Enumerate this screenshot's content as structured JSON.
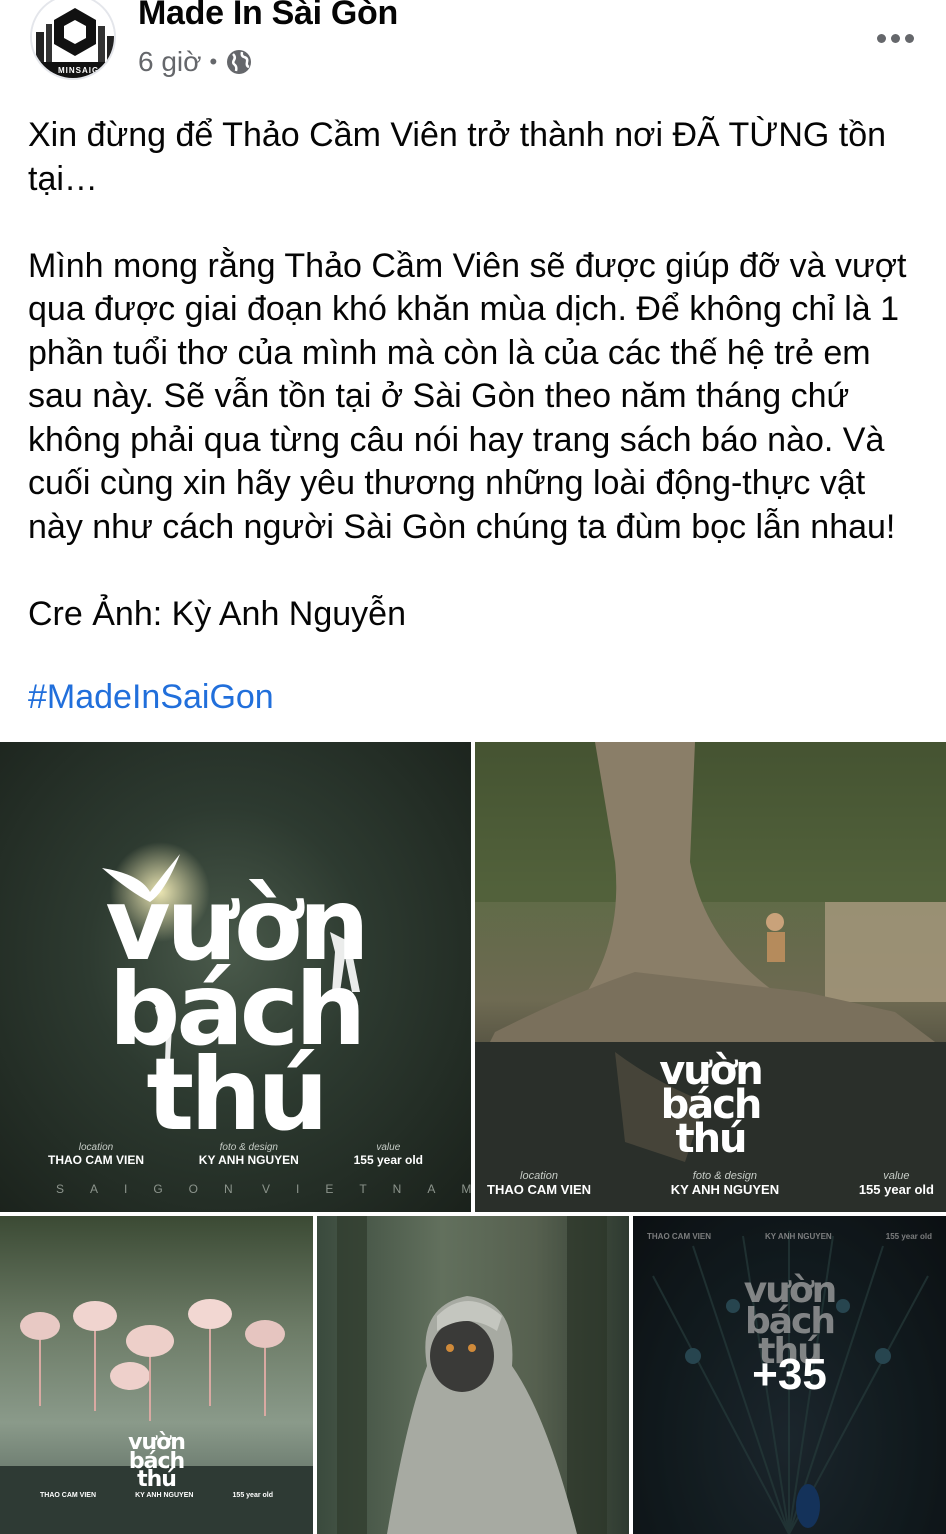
{
  "header": {
    "page_name": "Made In Sài Gòn",
    "time": "6 giờ",
    "separator": "•",
    "avatar_text": "MINSAIGON",
    "more_icon": "more-horizontal-icon",
    "privacy_icon": "globe-icon"
  },
  "post": {
    "text": "Xin đừng để Thảo Cầm Viên trở thành nơi ĐÃ TỪNG tồn tại…\n\nMình mong rằng Thảo Cầm Viên sẽ được giúp đỡ và vượt qua được giai đoạn khó khăn mùa dịch. Để không chỉ là 1 phần tuổi thơ của mình mà còn là của các thế hệ trẻ em sau này. Sẽ vẫn tồn tại ở Sài Gòn theo năm tháng chứ không phải qua từng câu nói hay trang sách báo nào. Và cuối cùng xin hãy yêu thương những loài động-thực vật này như cách người Sài Gòn chúng ta đùm bọc lẫn nhau!\n\nCre Ảnh: Kỳ Anh Nguyễn",
    "hashtag": "#MadeInSaiGon"
  },
  "poster": {
    "logo_line1": "vườn",
    "logo_line2": "bách",
    "logo_line3": "thú",
    "location_caption": "location",
    "location_value": "THAO CAM VIEN",
    "design_caption": "foto & design",
    "design_value": "KY ANH NGUYEN",
    "value_caption": "value",
    "value_value": "155 year old",
    "city": "SAIGON",
    "country": "VIETNAM"
  },
  "gallery": {
    "more_count": "+35"
  },
  "colors": {
    "text": "#050505",
    "secondary": "#65676b",
    "link": "#216fdb"
  }
}
